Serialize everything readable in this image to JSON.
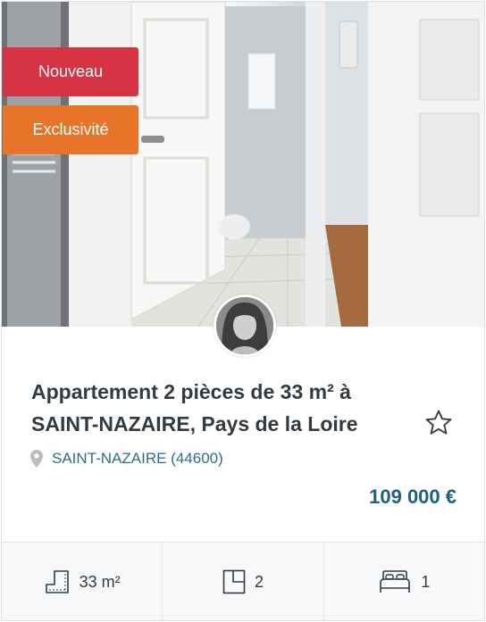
{
  "listing": {
    "badges": {
      "new": "Nouveau",
      "exclusive": "Exclusivité"
    },
    "title": "Appartement 2 pièces de 33 m² à SAINT-NAZAIRE, Pays de la Loire",
    "location": "SAINT-NAZAIRE (44600)",
    "price": "109 000 €",
    "features": {
      "surface": "33 m²",
      "rooms": "2",
      "bedrooms": "1"
    }
  },
  "colors": {
    "badge_new": "#d63344",
    "badge_exclusive": "#e8742a",
    "price": "#1f5f7e",
    "location": "#2f6e88"
  },
  "icons": {
    "favorite": "star-outline-icon",
    "location": "map-pin-icon",
    "surface": "surface-area-icon",
    "rooms": "floorplan-icon",
    "bedrooms": "bed-icon"
  }
}
